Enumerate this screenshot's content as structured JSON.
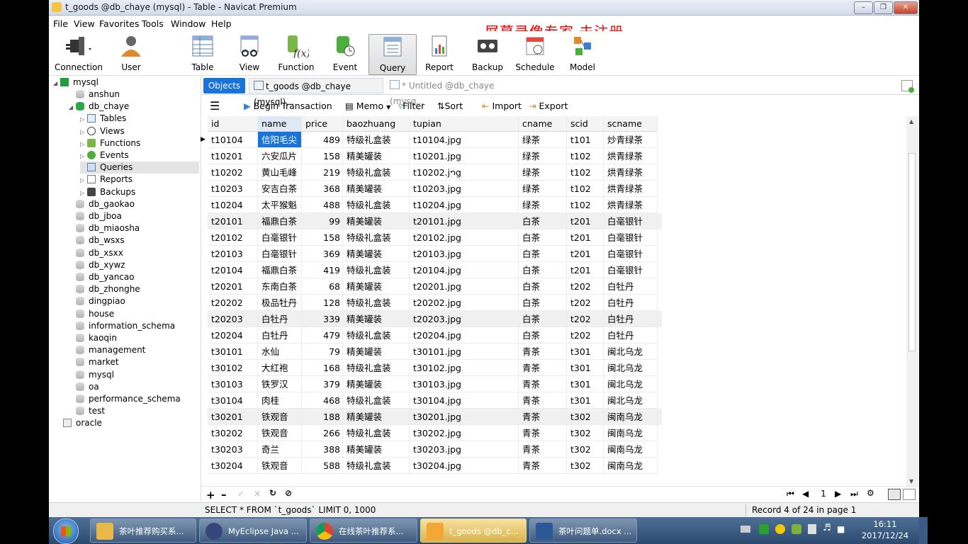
{
  "window": {
    "title": "t_goods @db_chaye (mysql) - Table - Navicat Premium"
  },
  "menu": [
    "File",
    "View",
    "Favorites",
    "Tools",
    "Window",
    "Help"
  ],
  "watermark": "屏幕录像专家  未注册",
  "toolbar": {
    "connection": "Connection",
    "user": "User",
    "table": "Table",
    "view": "View",
    "function": "Function",
    "event": "Event",
    "query": "Query",
    "report": "Report",
    "backup": "Backup",
    "schedule": "Schedule",
    "model": "Model"
  },
  "sidebar": {
    "root": "mysql",
    "items": [
      "anshun",
      "db_chaye",
      "Tables",
      "Views",
      "Functions",
      "Events",
      "Queries",
      "Reports",
      "Backups",
      "db_gaokao",
      "db_jboa",
      "db_miaosha",
      "db_wsxs",
      "db_xsxx",
      "db_xywz",
      "db_yancao",
      "db_zhonghe",
      "dingpiao",
      "house",
      "information_schema",
      "kaoqin",
      "management",
      "market",
      "mysql",
      "oa",
      "performance_schema",
      "test"
    ],
    "oracle": "oracle"
  },
  "tabs": {
    "objects": "Objects",
    "table_tab": "t_goods @db_chaye (mysql)...",
    "untitled_tab": "* Untitled @db_chaye (mysq..."
  },
  "subtoolbar": {
    "begin": "Begin Transaction",
    "memo": "Memo",
    "filter": "Filter",
    "sort": "Sort",
    "import": "Import",
    "export": "Export"
  },
  "columns": [
    "id",
    "name",
    "price",
    "baozhuang",
    "tupian",
    "cname",
    "scid",
    "scname"
  ],
  "rows": [
    [
      "t10104",
      "信阳毛尖",
      "489",
      "特级礼盒装",
      "t10104.jpg",
      "绿茶",
      "t101",
      "炒青绿茶"
    ],
    [
      "t10201",
      "六安瓜片",
      "158",
      "精美罐装",
      "t10201.jpg",
      "绿茶",
      "t102",
      "烘青绿茶"
    ],
    [
      "t10202",
      "黄山毛峰",
      "219",
      "特级礼盒装",
      "t10202.jpg",
      "绿茶",
      "t102",
      "烘青绿茶"
    ],
    [
      "t10203",
      "安吉白茶",
      "368",
      "精美罐装",
      "t10203.jpg",
      "绿茶",
      "t102",
      "烘青绿茶"
    ],
    [
      "t10204",
      "太平猴魁",
      "488",
      "特级礼盒装",
      "t10204.jpg",
      "绿茶",
      "t102",
      "烘青绿茶"
    ],
    [
      "t20101",
      "福鼎白茶",
      "99",
      "精美罐装",
      "t20101.jpg",
      "白茶",
      "t201",
      "白毫银针"
    ],
    [
      "t20102",
      "白毫银针",
      "158",
      "特级礼盒装",
      "t20102.jpg",
      "白茶",
      "t201",
      "白毫银针"
    ],
    [
      "t20103",
      "白毫银针",
      "369",
      "精美罐装",
      "t20103.jpg",
      "白茶",
      "t201",
      "白毫银针"
    ],
    [
      "t20104",
      "福鼎白茶",
      "419",
      "特级礼盒装",
      "t20104.jpg",
      "白茶",
      "t201",
      "白毫银针"
    ],
    [
      "t20201",
      "东南白茶",
      "68",
      "精美罐装",
      "t20201.jpg",
      "白茶",
      "t202",
      "白牡丹"
    ],
    [
      "t20202",
      "极品牡丹",
      "128",
      "特级礼盒装",
      "t20202.jpg",
      "白茶",
      "t202",
      "白牡丹"
    ],
    [
      "t20203",
      "白牡丹",
      "339",
      "精美罐装",
      "t20203.jpg",
      "白茶",
      "t202",
      "白牡丹"
    ],
    [
      "t20204",
      "白牡丹",
      "479",
      "特级礼盒装",
      "t20204.jpg",
      "白茶",
      "t202",
      "白牡丹"
    ],
    [
      "t30101",
      "水仙",
      "79",
      "精美罐装",
      "t30101.jpg",
      "青茶",
      "t301",
      "闽北乌龙"
    ],
    [
      "t30102",
      "大红袍",
      "168",
      "特级礼盒装",
      "t30102.jpg",
      "青茶",
      "t301",
      "闽北乌龙"
    ],
    [
      "t30103",
      "铁罗汉",
      "379",
      "精美罐装",
      "t30103.jpg",
      "青茶",
      "t301",
      "闽北乌龙"
    ],
    [
      "t30104",
      "肉桂",
      "468",
      "特级礼盒装",
      "t30104.jpg",
      "青茶",
      "t301",
      "闽北乌龙"
    ],
    [
      "t30201",
      "铁观音",
      "188",
      "精美罐装",
      "t30201.jpg",
      "青茶",
      "t302",
      "闽南乌龙"
    ],
    [
      "t30202",
      "铁观音",
      "266",
      "特级礼盒装",
      "t30202.jpg",
      "青茶",
      "t302",
      "闽南乌龙"
    ],
    [
      "t30203",
      "奇兰",
      "388",
      "精美罐装",
      "t30203.jpg",
      "青茶",
      "t302",
      "闽南乌龙"
    ],
    [
      "t30204",
      "铁观音",
      "588",
      "特级礼盒装",
      "t30204.jpg",
      "青茶",
      "t302",
      "闽南乌龙"
    ]
  ],
  "bottom": {
    "page": "1"
  },
  "status": {
    "sql": "SELECT * FROM `t_goods` LIMIT 0, 1000",
    "record": "Record 4 of 24 in page 1"
  },
  "taskbar": {
    "items": [
      "茶叶推荐购买系...",
      "MyEclipse Java ...",
      "在线茶叶推荐系...",
      "t_goods @db_c...",
      "茶叶问题单.docx ..."
    ],
    "time": "16:11",
    "date": "2017/12/24"
  },
  "colors": {
    "accent": "#1a73d9",
    "watermark": "#e00000",
    "selected_cell": "#1a73d9"
  }
}
